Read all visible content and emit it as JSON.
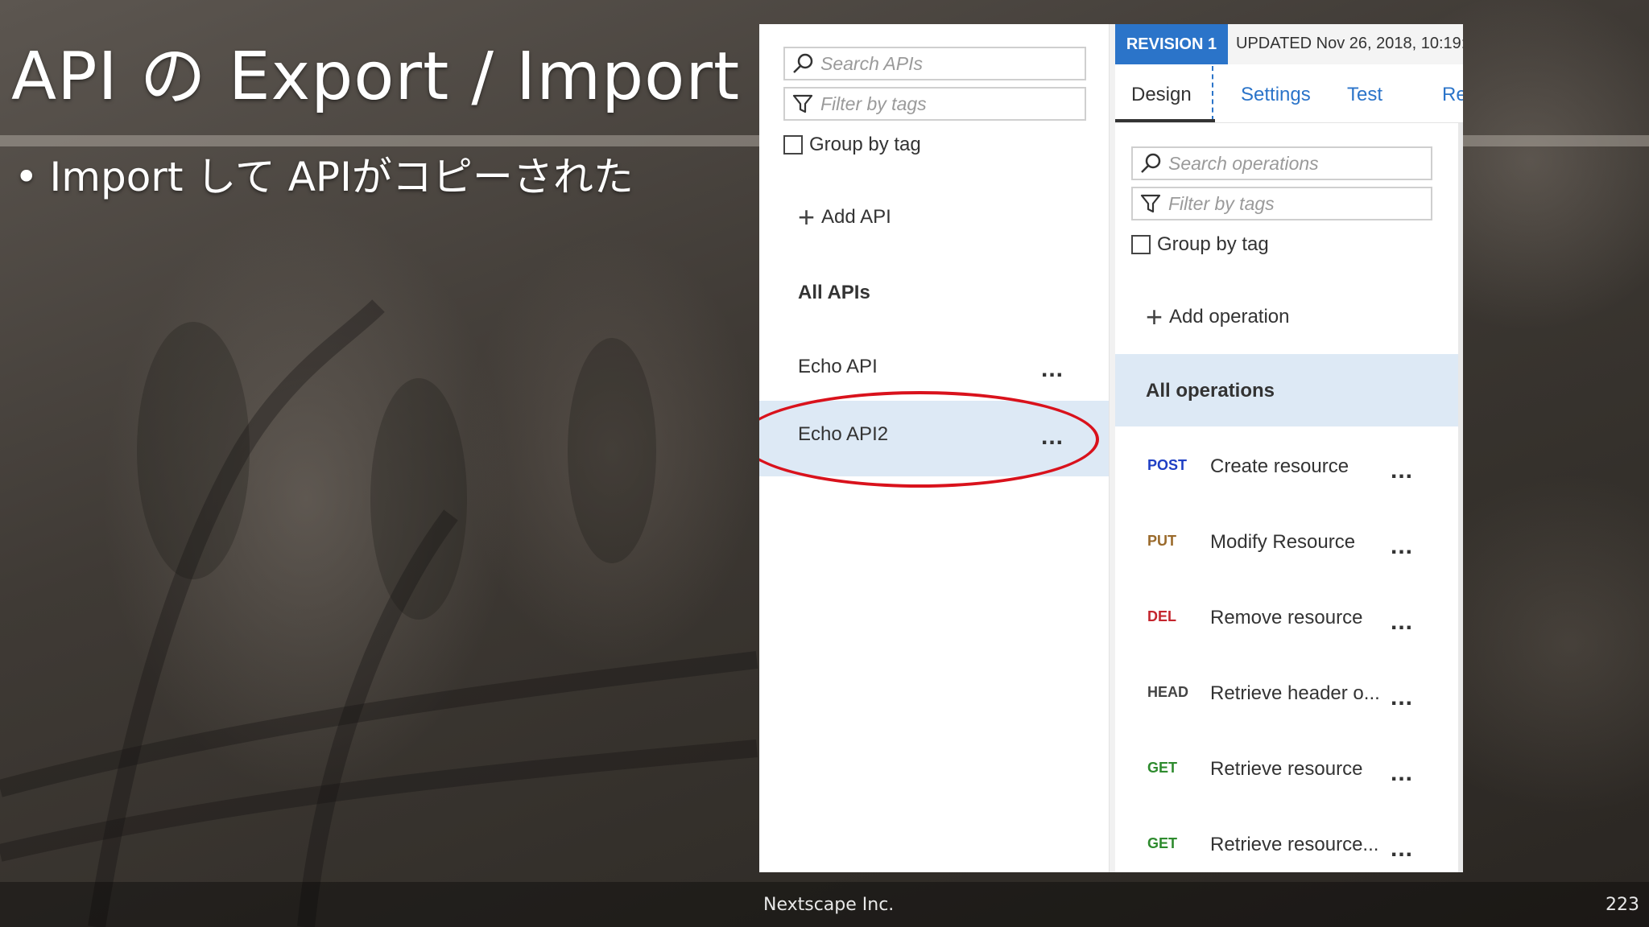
{
  "slide": {
    "title": "API の Export / Import",
    "bullet": "Import して APIがコピーされた",
    "footer_company": "Nextscape Inc.",
    "page_number": "223"
  },
  "left_panel": {
    "search_placeholder": "Search APIs",
    "filter_placeholder": "Filter by tags",
    "group_by_tag_label": "Group by tag",
    "group_by_tag_checked": false,
    "add_api_label": "Add API",
    "all_apis_label": "All APIs",
    "apis": [
      {
        "name": "Echo API",
        "selected": false
      },
      {
        "name": "Echo API2",
        "selected": true
      }
    ],
    "more_label": "..."
  },
  "right_panel": {
    "revision_badge": "REVISION 1",
    "updated_text": "UPDATED Nov 26, 2018, 10:19:5",
    "tabs": [
      {
        "label": "Design",
        "active": true
      },
      {
        "label": "Settings",
        "active": false
      },
      {
        "label": "Test",
        "active": false
      },
      {
        "label": "Re",
        "active": false
      }
    ],
    "search_placeholder": "Search operations",
    "filter_placeholder": "Filter by tags",
    "group_by_tag_label": "Group by tag",
    "add_operation_label": "Add operation",
    "all_operations_label": "All operations",
    "operations": [
      {
        "method": "POST",
        "name": "Create resource",
        "color": "#1f3fc4"
      },
      {
        "method": "PUT",
        "name": "Modify Resource",
        "color": "#9a6a2b"
      },
      {
        "method": "DEL",
        "name": "Remove resource",
        "color": "#c4262e"
      },
      {
        "method": "HEAD",
        "name": "Retrieve header o...",
        "color": "#444444"
      },
      {
        "method": "GET",
        "name": "Retrieve resource",
        "color": "#2e8b2e"
      },
      {
        "method": "GET",
        "name": "Retrieve resource...",
        "color": "#2e8b2e"
      }
    ]
  },
  "colors": {
    "accent_blue": "#2b74c9",
    "selection_bg": "#dde9f5",
    "highlight_red": "#d9121c"
  }
}
